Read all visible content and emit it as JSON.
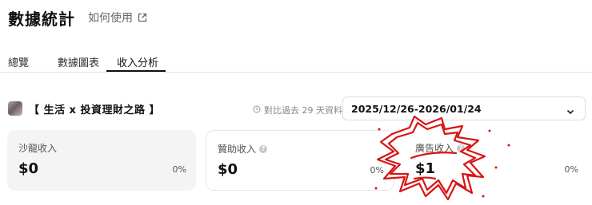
{
  "header": {
    "title": "數據統計",
    "howto_label": "如何使用",
    "howto_icon": "external-link-icon"
  },
  "tabs": [
    {
      "label": "總覽",
      "active": false
    },
    {
      "label": "數據圖表",
      "active": false
    },
    {
      "label": "收入分析",
      "active": true
    }
  ],
  "channel": {
    "name": "【 生活 x 投資理財之路 】",
    "compare_text": "對比過去 29 天資料",
    "date_range": "2025/12/26-2026/01/24"
  },
  "cards": [
    {
      "label": "沙龍收入",
      "amount": "$0",
      "percent": "0%",
      "has_help": false
    },
    {
      "label": "贊助收入",
      "amount": "$0",
      "percent": "0%",
      "has_help": true
    },
    {
      "label": "廣告收入",
      "amount": "$1",
      "percent": "0%",
      "has_help": true
    }
  ],
  "colors": {
    "annotation": "#d81414",
    "accent": "#111111"
  }
}
